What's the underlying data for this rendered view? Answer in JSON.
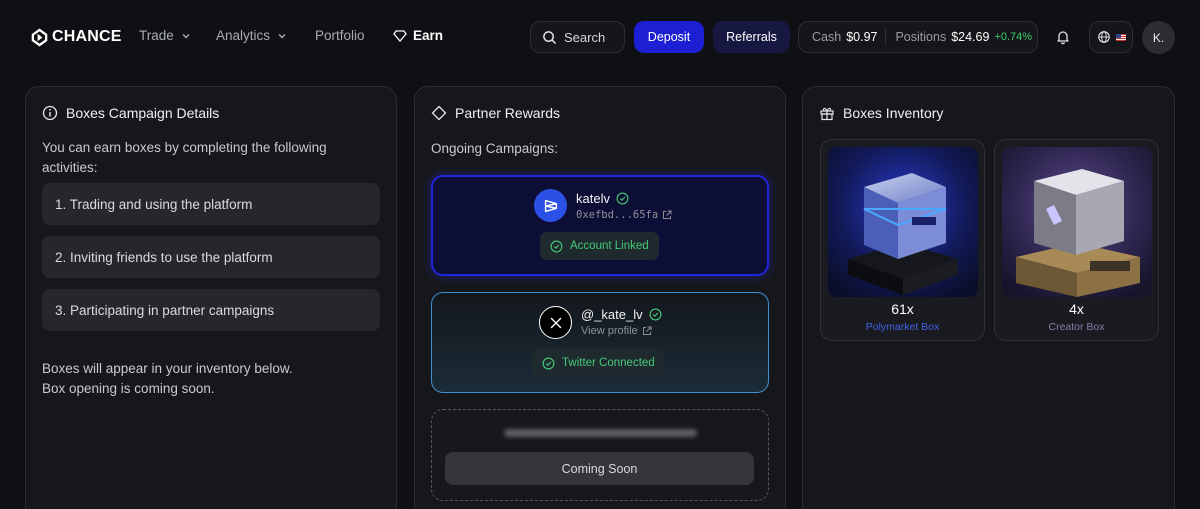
{
  "brand": {
    "name": "CHANCE"
  },
  "nav": {
    "trade": "Trade",
    "analytics": "Analytics",
    "portfolio": "Portfolio",
    "earn": "Earn"
  },
  "header": {
    "search_label": "Search",
    "deposit_label": "Deposit",
    "referrals_label": "Referrals",
    "cash_label": "Cash",
    "cash_value": "$0.97",
    "positions_label": "Positions",
    "positions_value": "$24.69",
    "positions_change": "+0.74%",
    "avatar_initial": "K."
  },
  "campaign": {
    "title": "Boxes Campaign Details",
    "intro": "You can earn boxes by completing the following activities:",
    "activities": [
      "1. Trading and using the platform",
      "2. Inviting friends to use the platform",
      "3. Participating in partner campaigns"
    ],
    "outro_line1": "Boxes will appear in your inventory below.",
    "outro_line2": "Box opening is coming soon."
  },
  "partner": {
    "title": "Partner Rewards",
    "ongoing_label": "Ongoing Campaigns:",
    "polymarket": {
      "username": "katelv",
      "address": "0xefbd...65fa",
      "status": "Account Linked"
    },
    "twitter": {
      "handle": "@_kate_lv",
      "link_label": "View profile",
      "status": "Twitter Connected"
    },
    "coming_soon_label": "Coming Soon"
  },
  "inventory": {
    "title": "Boxes Inventory",
    "boxes": [
      {
        "count": "61x",
        "name": "Polymarket Box",
        "name_color": "#3f63e6"
      },
      {
        "count": "4x",
        "name": "Creator Box",
        "name_color": "#8a7aa8"
      }
    ]
  },
  "colors": {
    "accent_blue": "#1c1fd4",
    "success_green": "#47c978",
    "positive_change": "#3ecf6c"
  }
}
